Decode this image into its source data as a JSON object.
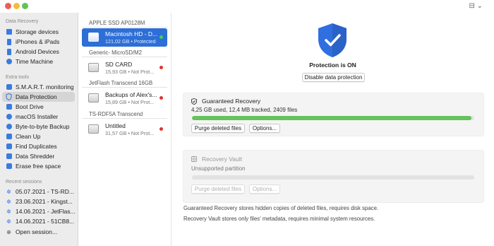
{
  "window": {
    "controls": "⊟ ⌄"
  },
  "sidebar": {
    "sections": {
      "data_recovery": "Data Recovery",
      "extra_tools": "Extra tools",
      "recent_sessions": "Recent sessions"
    },
    "data_recovery_items": [
      {
        "label": "Storage devices",
        "icon": "storage-icon"
      },
      {
        "label": "iPhones & iPads",
        "icon": "iphone-icon"
      },
      {
        "label": "Android Devices",
        "icon": "android-icon"
      },
      {
        "label": "Time Machine",
        "icon": "time-machine-icon"
      }
    ],
    "extra_tools_items": [
      {
        "label": "S.M.A.R.T. monitoring",
        "icon": "smart-icon"
      },
      {
        "label": "Data Protection",
        "icon": "shield-icon",
        "selected": true
      },
      {
        "label": "Boot Drive",
        "icon": "boot-drive-icon"
      },
      {
        "label": "macOS Installer",
        "icon": "installer-icon"
      },
      {
        "label": "Byte-to-byte Backup",
        "icon": "backup-icon"
      },
      {
        "label": "Clean Up",
        "icon": "cleanup-icon"
      },
      {
        "label": "Find Duplicates",
        "icon": "duplicates-icon"
      },
      {
        "label": "Data Shredder",
        "icon": "shredder-icon"
      },
      {
        "label": "Erase free space",
        "icon": "erase-icon"
      }
    ],
    "recent_sessions": [
      {
        "label": "05.07.2021 - TS-RD..."
      },
      {
        "label": "23.06.2021 - Kingst..."
      },
      {
        "label": "14.06.2021 - JetFlas..."
      },
      {
        "label": "14.06.2021 - 51CB8..."
      }
    ],
    "open_session": "Open session..."
  },
  "disks": {
    "groups": [
      {
        "header": "APPLE SSD AP0128M",
        "items": [
          {
            "name": "Macintosh HD - D...",
            "sub": "121,02 GB • Protected",
            "status_color": "#3fd15c",
            "selected": true
          }
        ]
      },
      {
        "header": "Generic- MicroSD/M2",
        "items": [
          {
            "name": "SD CARD",
            "sub": "15,93 GB • Not Prot...",
            "status_color": "#e0332f"
          }
        ]
      },
      {
        "header": "JetFlash Transcend 16GB",
        "items": [
          {
            "name": "Backups of Alex's...",
            "sub": "15,89 GB • Not Prot...",
            "status_color": "#e0332f"
          }
        ]
      },
      {
        "header": "TS-RDF5A Transcend",
        "items": [
          {
            "name": "Untitled",
            "sub": "31,57 GB • Not Prot...",
            "status_color": "#e0332f"
          }
        ]
      }
    ]
  },
  "main": {
    "protection_status": "Protection is ON",
    "disable_button": "Disable data protection",
    "guaranteed": {
      "title": "Guaranteed Recovery",
      "stats": "4,25 GB used, 12,4 MB tracked, 2409 files",
      "progress": 0.99,
      "purge_label": "Purge deleted files",
      "options_label": "Options..."
    },
    "vault": {
      "title": "Recovery Vault",
      "status": "Unsupported partition",
      "purge_label": "Purge deleted files",
      "options_label": "Options..."
    },
    "notes": [
      "Guaranteed Recovery stores hidden copies of deleted files, requires disk space.",
      "Recovery Vault stores only files' metadata, requires minimal system resources."
    ]
  },
  "colors": {
    "accent": "#2d6fd6",
    "progress": "#65c25c",
    "shield": "#2f6fe0",
    "protected_dot": "#3fd15c",
    "unprotected_dot": "#e0332f"
  }
}
